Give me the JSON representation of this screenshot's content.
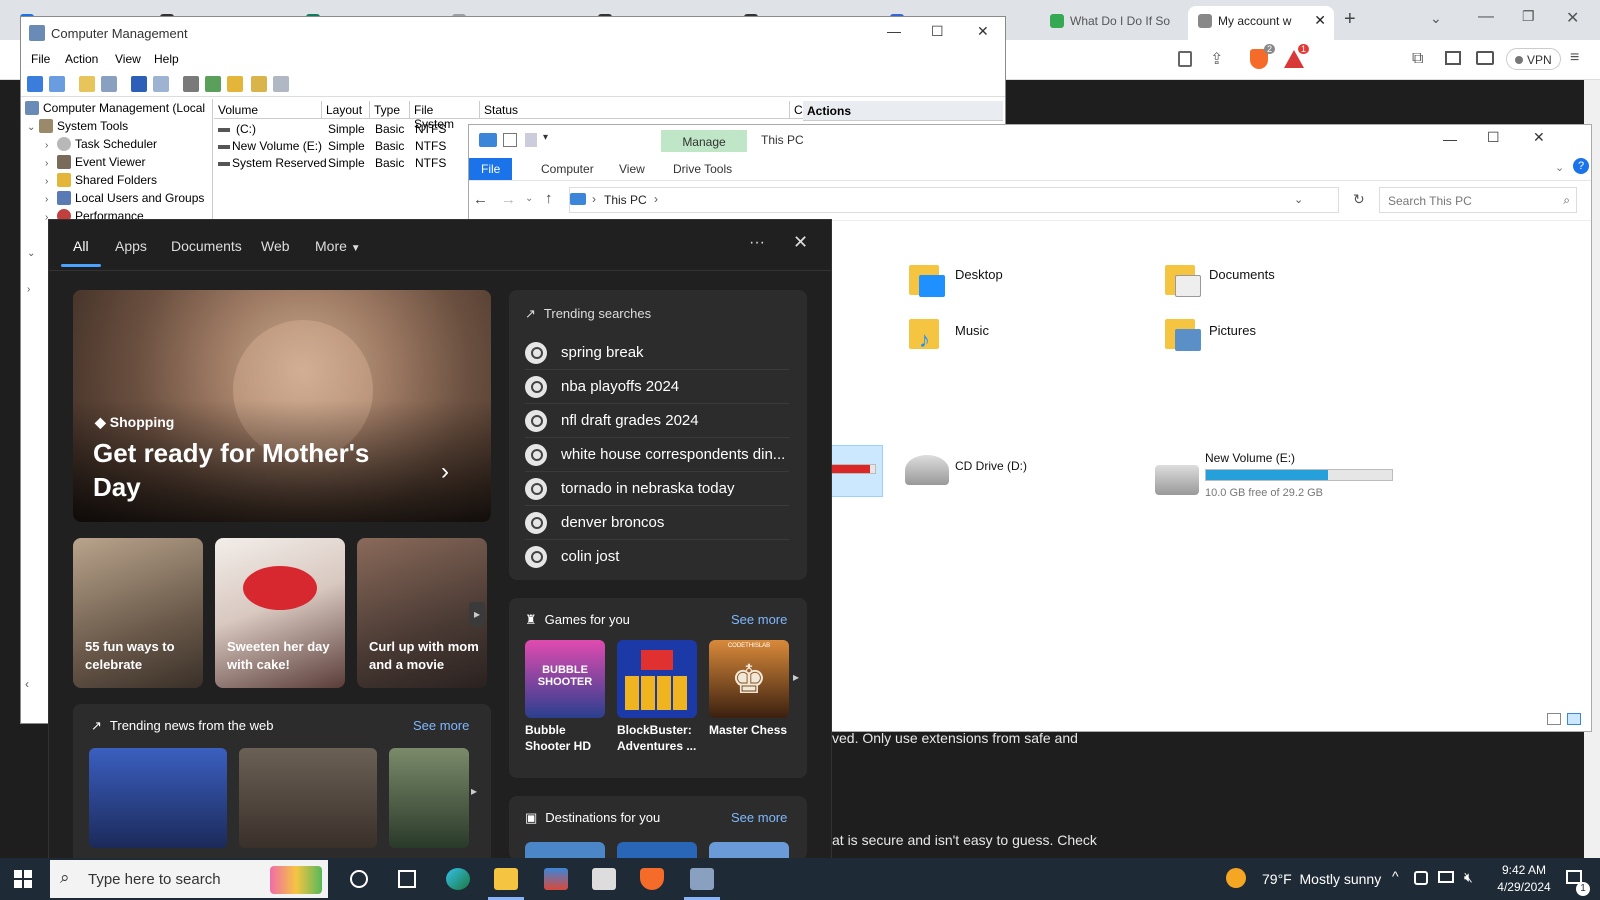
{
  "browser": {
    "tabs": [
      {
        "label": "",
        "color": "#1a73e8"
      },
      {
        "label": "",
        "color": "#333333"
      },
      {
        "label": "",
        "color": "#0f7b5f"
      },
      {
        "label": "",
        "color": "#9aa0a6"
      },
      {
        "label": "",
        "color": "#333333"
      },
      {
        "label": "",
        "color": "#333333"
      },
      {
        "label": "",
        "color": "#3367d6"
      },
      {
        "label": "What Do I Do If So",
        "color": "#34a853"
      },
      {
        "label": "My account w",
        "color": "#888888"
      }
    ],
    "vpn_label": "VPN",
    "badge_shield": "2",
    "badge_rewards": "1",
    "content_line1": "ved. Only use extensions from safe and",
    "content_line2": "at is secure and isn't easy to guess. Check"
  },
  "computer_management": {
    "title": "Computer Management",
    "menu": [
      "File",
      "Action",
      "View",
      "Help"
    ],
    "tree": [
      {
        "label": "Computer Management (Local",
        "level": 0
      },
      {
        "label": "System Tools",
        "level": 1
      },
      {
        "label": "Task Scheduler",
        "level": 2
      },
      {
        "label": "Event Viewer",
        "level": 2
      },
      {
        "label": "Shared Folders",
        "level": 2
      },
      {
        "label": "Local Users and Groups",
        "level": 2
      },
      {
        "label": "Performance",
        "level": 2
      }
    ],
    "columns": [
      "Volume",
      "Layout",
      "Type",
      "File System",
      "Status",
      "C"
    ],
    "volumes": [
      {
        "volume": "(C:)",
        "layout": "Simple",
        "type": "Basic",
        "fs": "NTFS"
      },
      {
        "volume": "New Volume (E:)",
        "layout": "Simple",
        "type": "Basic",
        "fs": "NTFS"
      },
      {
        "volume": "System Reserved",
        "layout": "Simple",
        "type": "Basic",
        "fs": "NTFS"
      }
    ],
    "actions_label": "Actions"
  },
  "explorer": {
    "manage_label": "Manage",
    "title": "This PC",
    "ribbon_tabs": [
      "File",
      "Computer",
      "View",
      "Drive Tools"
    ],
    "breadcrumb": "This PC",
    "search_placeholder": "Search This PC",
    "folders": [
      {
        "label": "Desktop",
        "accent": "#1e90ff"
      },
      {
        "label": "Documents",
        "accent": "#e8e8e8"
      },
      {
        "label": "Music",
        "accent": "#1e90ff"
      },
      {
        "label": "Pictures",
        "accent": "#5b8fc7"
      }
    ],
    "cd_drive": "CD Drive (D:)",
    "new_volume": {
      "label": "New Volume (E:)",
      "free_text": "10.0 GB free of 29.2 GB",
      "used_fraction": 0.658
    },
    "c_used_fraction": 0.9
  },
  "search": {
    "tabs": [
      "All",
      "Apps",
      "Documents",
      "Web",
      "More"
    ],
    "more_menu": "···",
    "hero": {
      "category": "Shopping",
      "title": "Get ready for Mother's Day"
    },
    "cards": [
      {
        "label": "55 fun ways to celebrate"
      },
      {
        "label": "Sweeten her day with cake!"
      },
      {
        "label": "Curl up with mom and a movie"
      }
    ],
    "trending_title": "Trending searches",
    "trending": [
      "spring break",
      "nba playoffs 2024",
      "nfl draft grades 2024",
      "white house correspondents din...",
      "tornado in nebraska today",
      "denver broncos",
      "colin jost"
    ],
    "games_title": "Games for you",
    "games": [
      {
        "name": "Bubble Shooter HD",
        "logo": "BUBBLE SHOOTER"
      },
      {
        "name": "BlockBuster: Adventures ...",
        "logo": ""
      },
      {
        "name": "Master Chess",
        "logo": "CODETHISLAB"
      }
    ],
    "news_title": "Trending news from the web",
    "destinations_title": "Destinations for you",
    "see_more": "See more"
  },
  "taskbar": {
    "search_placeholder": "Type here to search",
    "weather": "79°F  Mostly sunny",
    "time": "9:42 AM",
    "date": "4/29/2024",
    "notification_count": "1"
  }
}
